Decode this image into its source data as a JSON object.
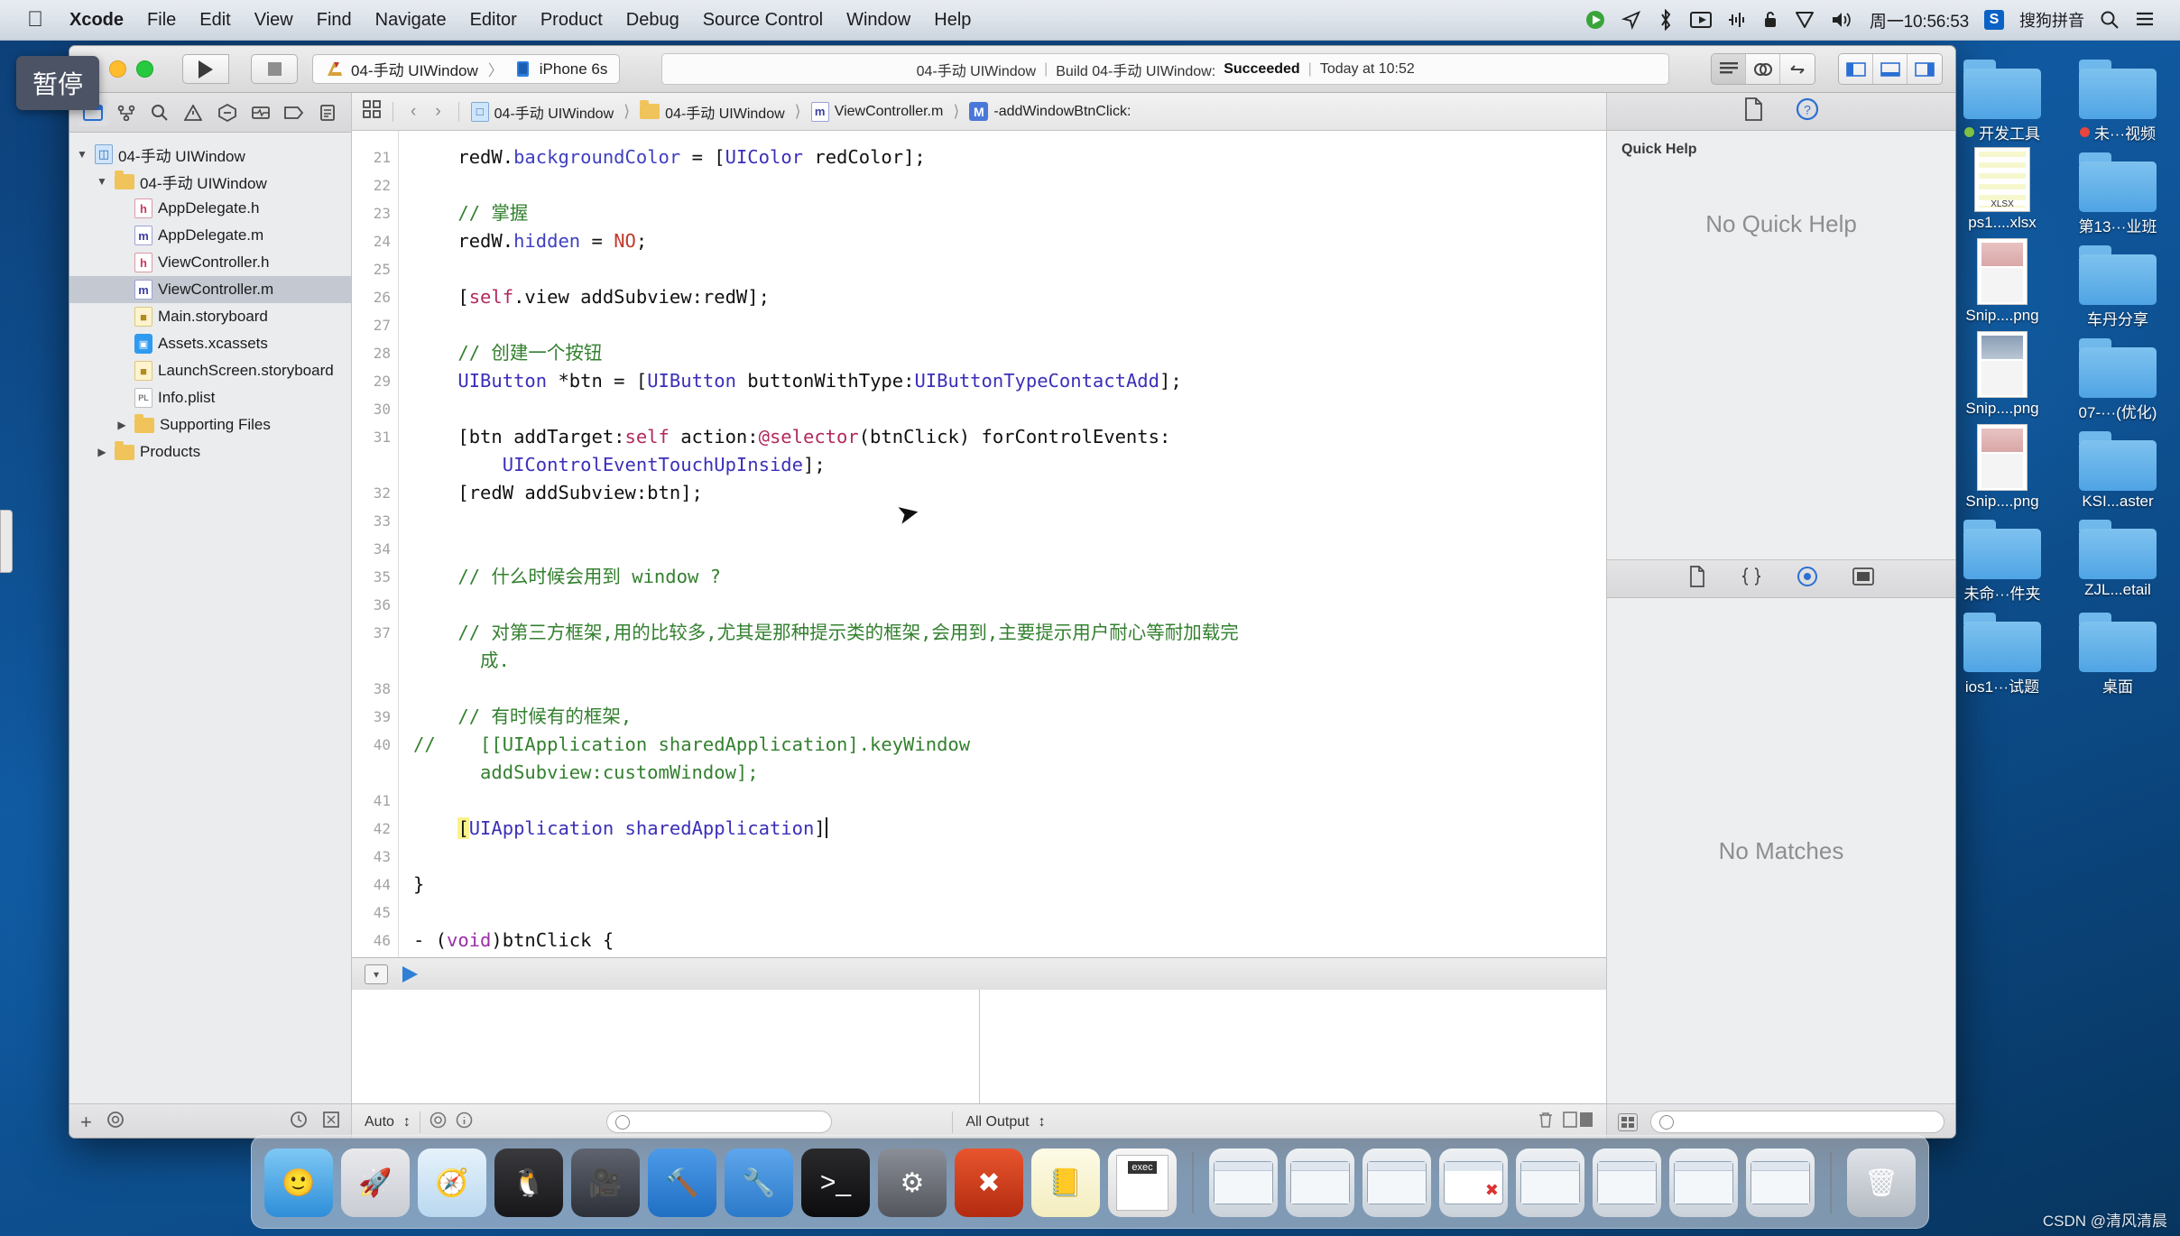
{
  "menubar": {
    "apple": "apple-logo",
    "items": [
      {
        "label": "Xcode",
        "bold": true
      },
      {
        "label": "File"
      },
      {
        "label": "Edit"
      },
      {
        "label": "View"
      },
      {
        "label": "Find"
      },
      {
        "label": "Navigate"
      },
      {
        "label": "Editor"
      },
      {
        "label": "Product"
      },
      {
        "label": "Debug"
      },
      {
        "label": "Source Control"
      },
      {
        "label": "Window"
      },
      {
        "label": "Help"
      }
    ],
    "right": {
      "clock": "周一10:56:53",
      "ime_badge": "S",
      "ime_label": "搜狗拼音",
      "icons": [
        "screen-record-icon",
        "location-icon",
        "bluetooth-icon",
        "screen-mirror-icon",
        "equalizer-icon",
        "lock-icon",
        "vpn-shield-icon",
        "volume-icon",
        "spotlight-search-icon",
        "notification-center-icon"
      ]
    }
  },
  "tooltip": {
    "text": "暂停"
  },
  "xcode": {
    "toolbar": {
      "run_label": "run-button",
      "stop_label": "stop-button",
      "scheme_project": "04-手动 UIWindow",
      "scheme_device": "iPhone 6s",
      "scheme_separator": "〉",
      "status": {
        "project": "04-手动 UIWindow",
        "sep": "|",
        "build_text": "Build 04-手动 UIWindow:",
        "build_result": "Succeeded",
        "time": "Today at 10:52"
      },
      "right_segments": [
        "editor-standard-icon",
        "editor-assistant-icon",
        "editor-version-icon",
        "panel-left-icon",
        "panel-bottom-icon",
        "panel-right-icon"
      ]
    },
    "navigator": {
      "tabs": [
        "folder-navigator-icon",
        "source-control-icon",
        "search-icon",
        "issue-navigator-icon",
        "test-navigator-icon",
        "debug-navigator-icon",
        "breakpoint-navigator-icon",
        "report-navigator-icon"
      ],
      "tree": [
        {
          "label": "04-手动 UIWindow",
          "icon": "project-icon",
          "depth": 0,
          "twisty": "▼",
          "selected": false
        },
        {
          "label": "04-手动 UIWindow",
          "icon": "folder-icon",
          "depth": 1,
          "twisty": "▼",
          "selected": false
        },
        {
          "label": "AppDelegate.h",
          "icon": "header-file-icon",
          "depth": 2,
          "twisty": "",
          "selected": false
        },
        {
          "label": "AppDelegate.m",
          "icon": "source-file-icon",
          "depth": 2,
          "twisty": "",
          "selected": false
        },
        {
          "label": "ViewController.h",
          "icon": "header-file-icon",
          "depth": 2,
          "twisty": "",
          "selected": false
        },
        {
          "label": "ViewController.m",
          "icon": "source-file-icon",
          "depth": 2,
          "twisty": "",
          "selected": true
        },
        {
          "label": "Main.storyboard",
          "icon": "storyboard-icon",
          "depth": 2,
          "twisty": "",
          "selected": false
        },
        {
          "label": "Assets.xcassets",
          "icon": "assets-icon",
          "depth": 2,
          "twisty": "",
          "selected": false
        },
        {
          "label": "LaunchScreen.storyboard",
          "icon": "storyboard-icon",
          "depth": 2,
          "twisty": "",
          "selected": false
        },
        {
          "label": "Info.plist",
          "icon": "plist-icon",
          "depth": 2,
          "twisty": "",
          "selected": false
        },
        {
          "label": "Supporting Files",
          "icon": "folder-icon",
          "depth": 2,
          "twisty": "▶",
          "selected": false
        },
        {
          "label": "Products",
          "icon": "folder-icon",
          "depth": 1,
          "twisty": "▶",
          "selected": false
        }
      ],
      "footer": {
        "add": "+",
        "filter": "filter-icon"
      }
    },
    "jumpbar": {
      "related_icon": "related-files-icon",
      "back": "‹",
      "forward": "›",
      "crumbs": [
        {
          "label": "04-手动 UIWindow",
          "icon": "project-icon"
        },
        {
          "label": "04-手动 UIWindow",
          "icon": "folder-icon"
        },
        {
          "label": "ViewController.m",
          "icon": "source-file-icon"
        },
        {
          "label": "-addWindowBtnClick:",
          "icon": "method-icon"
        }
      ]
    },
    "code": {
      "line_numbers": [
        "21",
        "22",
        "23",
        "24",
        "25",
        "26",
        "27",
        "28",
        "29",
        "30",
        "31",
        "",
        "32",
        "33",
        "34",
        "35",
        "36",
        "37",
        "",
        "38",
        "39",
        "40",
        "",
        "41",
        "42",
        "43",
        "44",
        "45",
        "46"
      ],
      "lines": [
        "    redW.backgroundColor = [UIColor redColor];",
        "",
        "    // 掌握",
        "    redW.hidden = NO;",
        "",
        "    [self.view addSubview:redW];",
        "",
        "    // 创建一个按钮",
        "    UIButton *btn = [UIButton buttonWithType:UIButtonTypeContactAdd];",
        "",
        "    [btn addTarget:self action:@selector(btnClick) forControlEvents:",
        "        UIControlEventTouchUpInside];",
        "    [redW addSubview:btn];",
        "",
        "",
        "    // 什么时候会用到 window ?",
        "",
        "    // 对第三方框架,用的比较多,尤其是那种提示类的框架,会用到,主要提示用户耐心等耐加载完",
        "      成.",
        "",
        "    // 有时候有的框架,",
        "//    [[UIApplication sharedApplication].keyWindow",
        "      addSubview:customWindow];",
        "",
        "    [UIApplication sharedApplication]",
        "",
        "}",
        "",
        "- (void)btnClick {"
      ]
    },
    "debug": {
      "left_filter": "Auto",
      "output_filter": "All Output",
      "search_placeholder": "",
      "trash_icon": "trash-icon"
    },
    "inspector": {
      "tabs": [
        "file-inspector-icon",
        "quick-help-icon"
      ],
      "quick_help_title": "Quick Help",
      "quick_help_empty": "No Quick Help",
      "library_tabs": [
        "file-template-library-icon",
        "code-snippet-library-icon",
        "object-library-icon",
        "media-library-icon"
      ],
      "library_empty": "No Matches"
    }
  },
  "desktop": {
    "icons": [
      {
        "label": "开发工具",
        "type": "folder",
        "dot": "#7dc242"
      },
      {
        "label": "未···视频",
        "type": "folder",
        "dot": "#e8453c"
      },
      {
        "label": "ps1....xlsx",
        "type": "xlsx",
        "dot": ""
      },
      {
        "label": "第13···业班",
        "type": "folder",
        "dot": ""
      },
      {
        "label": "Snip....png",
        "type": "png",
        "dot": ""
      },
      {
        "label": "车丹分享",
        "type": "folder",
        "dot": ""
      },
      {
        "label": "Snip....png",
        "type": "png2",
        "dot": ""
      },
      {
        "label": "07-···(优化)",
        "type": "folder",
        "dot": ""
      },
      {
        "label": "Snip....png",
        "type": "png",
        "dot": ""
      },
      {
        "label": "KSI...aster",
        "type": "folder",
        "dot": ""
      },
      {
        "label": "未命···件夹",
        "type": "folder",
        "dot": ""
      },
      {
        "label": "ZJL...etail",
        "type": "folder",
        "dot": ""
      },
      {
        "label": "ios1···试题",
        "type": "folder",
        "dot": ""
      },
      {
        "label": "桌面",
        "type": "folder",
        "dot": ""
      }
    ]
  },
  "dock": {
    "items": [
      {
        "name": "finder",
        "glyph": "🙂",
        "running": true
      },
      {
        "name": "launchpad",
        "glyph": "🚀",
        "running": false
      },
      {
        "name": "safari",
        "glyph": "🧭",
        "running": false
      },
      {
        "name": "app-dark",
        "glyph": "🐧",
        "running": true
      },
      {
        "name": "camera",
        "glyph": "🎥",
        "running": false
      },
      {
        "name": "xcode",
        "glyph": "🔨",
        "running": true
      },
      {
        "name": "xcode-2",
        "glyph": "🔧",
        "running": false
      },
      {
        "name": "terminal",
        "glyph": ">_",
        "running": false
      },
      {
        "name": "settings",
        "glyph": "⚙",
        "running": false
      },
      {
        "name": "charles",
        "glyph": "✖",
        "running": false
      },
      {
        "name": "notes",
        "glyph": "📒",
        "running": false
      },
      {
        "name": "exec",
        "glyph": "exec",
        "running": false
      },
      {
        "name": "window-1",
        "glyph": "▤",
        "running": false
      },
      {
        "name": "window-2",
        "glyph": "▤",
        "running": false
      },
      {
        "name": "window-3",
        "glyph": "▤",
        "running": false
      },
      {
        "name": "window-red-x",
        "glyph": "▤",
        "running": false
      },
      {
        "name": "window-4",
        "glyph": "▤",
        "running": false
      },
      {
        "name": "window-5",
        "glyph": "▤",
        "running": false
      },
      {
        "name": "window-6",
        "glyph": "▤",
        "running": false
      },
      {
        "name": "window-7",
        "glyph": "▤",
        "running": false
      },
      {
        "name": "trash",
        "glyph": "🗑",
        "running": false
      }
    ]
  },
  "watermark": {
    "text": "CSDN @清风清晨"
  }
}
